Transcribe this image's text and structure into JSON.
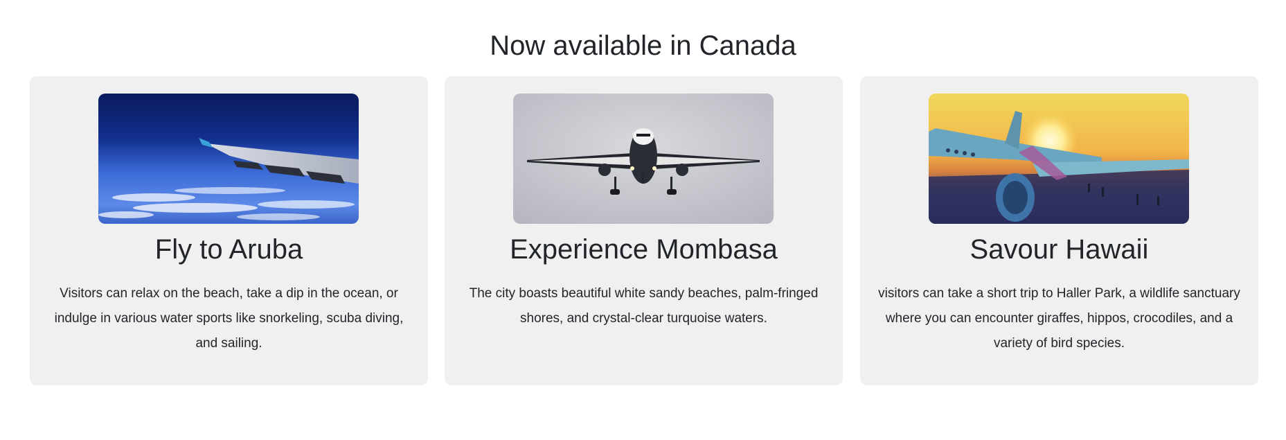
{
  "section": {
    "title": "Now available in Canada"
  },
  "cards": [
    {
      "title": "Fly to Aruba",
      "text": "Visitors can relax on the beach, take a dip in the ocean, or indulge in various water sports like snorkeling, scuba diving, and sailing.",
      "image": "airplane-wing-over-clouds"
    },
    {
      "title": "Experience Mombasa",
      "text": "The city boasts beautiful white sandy beaches, palm-fringed shores, and crystal-clear turquoise waters.",
      "image": "airplane-front-view"
    },
    {
      "title": "Savour Hawaii",
      "text": "visitors can take a short trip to Haller Park, a wildlife sanctuary where you can encounter giraffes, hippos, crocodiles, and a variety of bird species.",
      "image": "airplane-at-sunset-tarmac"
    }
  ],
  "colors": {
    "card_background": "#f0f0f0",
    "text": "#212529",
    "page_background": "#ffffff"
  }
}
